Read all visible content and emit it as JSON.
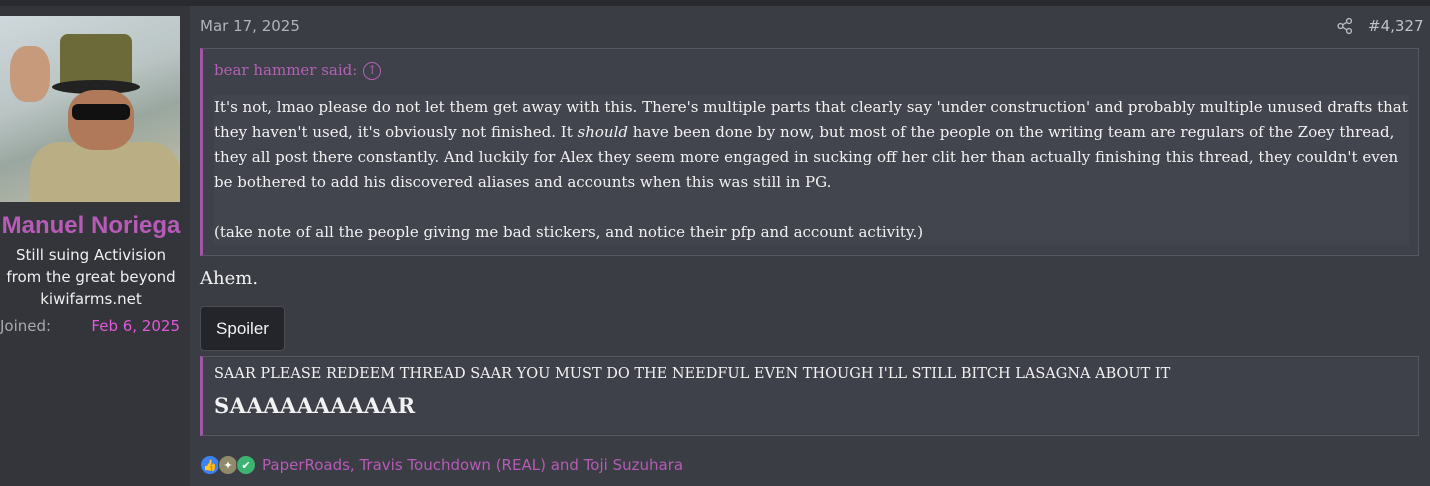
{
  "user": {
    "name": "Manuel Noriega",
    "title": "Still suing Activision from the great beyond",
    "site": "kiwifarms.net",
    "joined_label": "Joined:",
    "joined_date": "Feb 6, 2025"
  },
  "post": {
    "date": "Mar 17, 2025",
    "number": "#4,327",
    "quote": {
      "author_line": "bear hammer said:",
      "para1_before": "It's not, lmao please do not let them get away with this. There's multiple parts that clearly say 'under construction' and probably multiple unused drafts that they haven't used, it's obviously not finished. It ",
      "para1_em": "should",
      "para1_after": " have been done by now, but most of the people on the writing team are regulars of the Zoey thread, they all post there constantly. And luckily for Alex they seem more engaged in sucking off her clit her than actually finishing this thread, they couldn't even be bothered to add his discovered aliases and accounts when this was still in PG.",
      "para2": "(take note of all the people giving me bad stickers, and notice their pfp and account activity.)"
    },
    "body_text": "Ahem.",
    "spoiler_label": "Spoiler",
    "spoiler_line1": "SAAR PLEASE REDEEM THREAD SAAR YOU MUST DO THE NEEDFUL EVEN THOUGH I'LL STILL BITCH LASAGNA ABOUT IT",
    "spoiler_line2": "SAAAAAAAAAAR",
    "reactions_text": "PaperRoads, Travis Touchdown (REAL) and Toji Suzuhara"
  },
  "icons": [
    "share-icon",
    "arrow-up-icon",
    "like-icon",
    "sticker-icon",
    "check-icon"
  ],
  "colors": {
    "accent": "#b65bb6",
    "joined_date": "#e05ad8",
    "background": "#3b3d45",
    "sidebar": "#33353b"
  }
}
